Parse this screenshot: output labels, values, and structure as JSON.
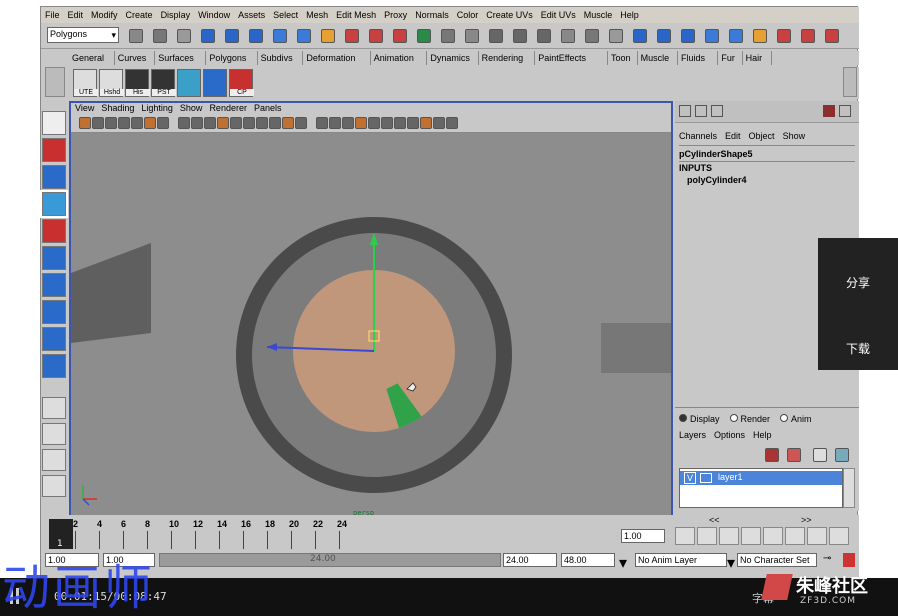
{
  "menubar": [
    "File",
    "Edit",
    "Modify",
    "Create",
    "Display",
    "Window",
    "Assets",
    "Select",
    "Mesh",
    "Edit Mesh",
    "Proxy",
    "Normals",
    "Color",
    "Create UVs",
    "Edit UVs",
    "Muscle",
    "Help"
  ],
  "menuset": "Polygons",
  "shelf_tabs": [
    "General",
    "Curves",
    "Surfaces",
    "Polygons",
    "Subdivs",
    "Deformation",
    "Animation",
    "Dynamics",
    "Rendering",
    "PaintEffects",
    "Toon",
    "Muscle",
    "Fluids",
    "Fur",
    "Hair"
  ],
  "shelf_buttons": [
    "UTE",
    "Hshd",
    "His",
    "PST",
    "",
    "",
    "CP"
  ],
  "viewport_menu": [
    "View",
    "Shading",
    "Lighting",
    "Show",
    "Renderer",
    "Panels"
  ],
  "channel_box": {
    "menu": [
      "Channels",
      "Edit",
      "Object",
      "Show"
    ],
    "shape": "pCylinderShape5",
    "inputs": "INPUTS",
    "node": "polyCylinder4"
  },
  "layer_editor": {
    "modes": [
      "Display",
      "Render",
      "Anim"
    ],
    "menu": [
      "Layers",
      "Options",
      "Help"
    ],
    "row_v": "V",
    "layer": "layer1",
    "nav_left": "<<",
    "nav_right": ">>"
  },
  "timeline": {
    "ticks": [
      "2",
      "4",
      "6",
      "8",
      "10",
      "12",
      "14",
      "16",
      "18",
      "20",
      "22",
      "24"
    ],
    "current_frame": "1",
    "frame_field": "1.00"
  },
  "range": {
    "start": "1.00",
    "start2": "1.00",
    "end": "24.00",
    "end2": "48.00",
    "mid": "24.00",
    "anim_layer": "No Anim Layer",
    "char_set": "No Character Set"
  },
  "side": {
    "share": "分享",
    "download": "下载"
  },
  "video": {
    "time": "00:01:15",
    "duration": "00:08:47",
    "subtitle": "字幕",
    "watermark_left": "动画师",
    "watermark_right": "朱峰社区",
    "watermark_url": "ZF3D.COM"
  },
  "viewport_label": "persp",
  "colors": {
    "accent": "#3c56b0",
    "wire": "#6ee0ff",
    "face": "#c99a7c",
    "selected": "#2fa24a"
  }
}
